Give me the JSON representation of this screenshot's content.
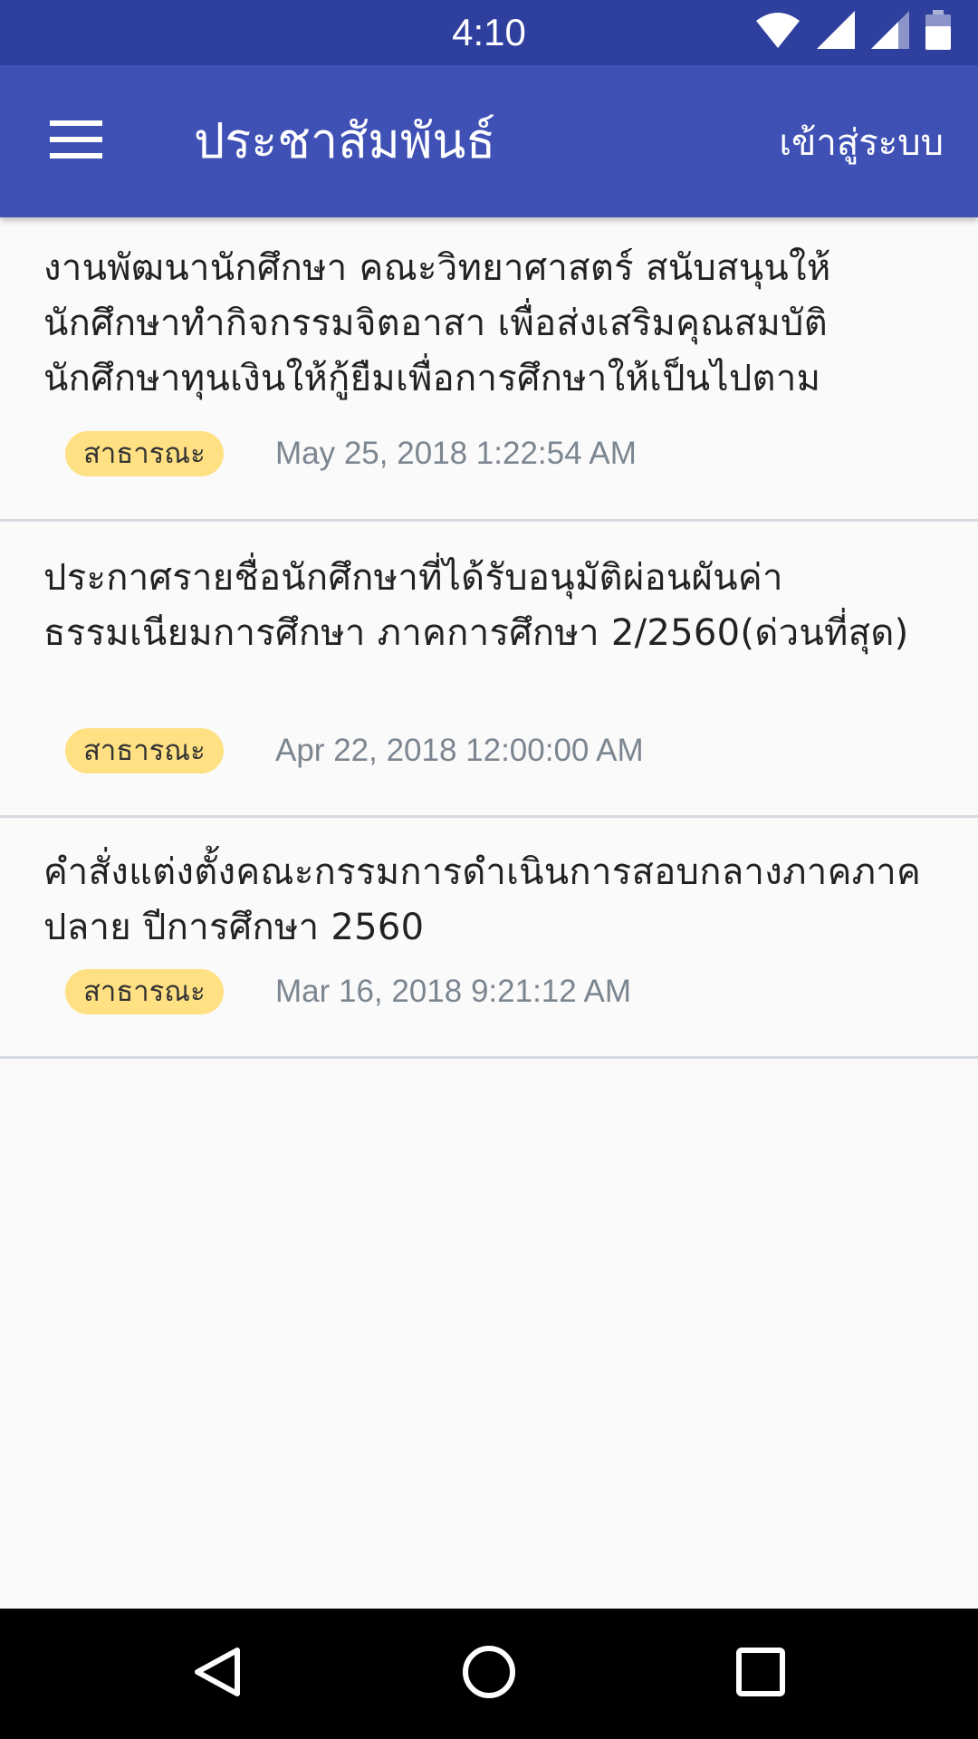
{
  "status_bar": {
    "time": "4:10",
    "icons": [
      "wifi-icon",
      "cell-signal-icon",
      "cell-signal-icon",
      "battery-icon"
    ]
  },
  "app_bar": {
    "menu_icon": "menu-icon",
    "title": "ประชาสัมพันธ์",
    "login_label": "เข้าสู่ระบบ"
  },
  "news": [
    {
      "title": " งานพัฒนานักศึกษา คณะวิทยาศาสตร์ สนับสนุนให้นักศึกษาทำกิจกรรมจิตอาสา เพื่อส่งเสริมคุณสมบัตินักศึกษาทุนเงินให้กู้ยืมเพื่อการศึกษาให้เป็นไปตาม",
      "badge": "สาธารณะ",
      "date": "May 25, 2018 1:22:54 AM"
    },
    {
      "title": "ประกาศรายชื่อนักศึกษาที่ได้รับอนุมัติผ่อนผันค่าธรรมเนียมการศึกษา ภาคการศึกษา 2/2560(ด่วนที่สุด)",
      "badge": "สาธารณะ",
      "date": "Apr 22, 2018 12:00:00 AM"
    },
    {
      "title": "คำสั่งแต่งตั้งคณะกรรมการดำเนินการสอบกลางภาคภาคปลาย ปีการศึกษา 2560",
      "badge": "สาธารณะ",
      "date": "Mar 16, 2018 9:21:12 AM"
    }
  ],
  "nav_bar": {
    "icons": [
      "back-icon",
      "home-icon",
      "recents-icon"
    ]
  },
  "colors": {
    "status_bar": "#2f3f9e",
    "app_bar": "#3f51b5",
    "badge": "#ffe082",
    "background": "#fafafa",
    "divider": "#d6dbe1",
    "timestamp": "#7c8691"
  }
}
